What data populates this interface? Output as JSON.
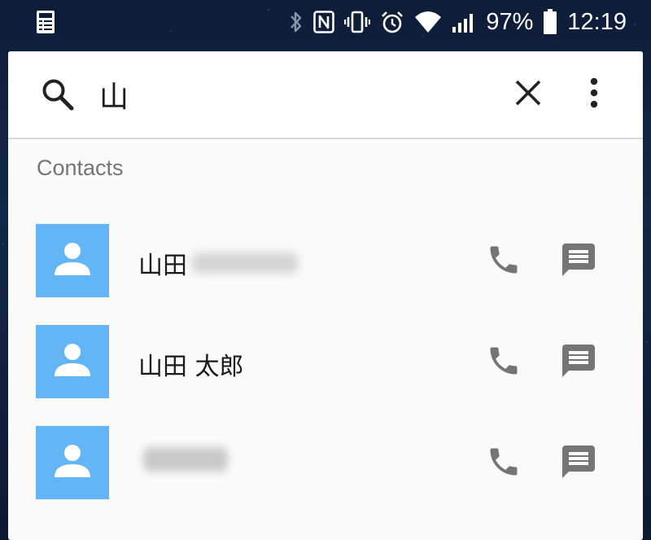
{
  "status_bar": {
    "battery_percent": "97%",
    "time": "12:19"
  },
  "search": {
    "query": "山"
  },
  "section": {
    "title": "Contacts"
  },
  "contacts": [
    {
      "name": "山田",
      "name_redacted": true
    },
    {
      "name": "山田 太郎",
      "name_redacted": false
    },
    {
      "name": "",
      "name_redacted": true
    }
  ],
  "icons": {
    "status": [
      "notification-app-icon",
      "bluetooth-icon",
      "nfc-icon",
      "vibrate-icon",
      "alarm-icon",
      "wifi-icon",
      "signal-icon",
      "battery-icon"
    ],
    "search_bar": [
      "search-icon",
      "close-icon",
      "more-vert-icon"
    ],
    "contact_row": [
      "person-icon",
      "phone-icon",
      "message-icon"
    ]
  },
  "colors": {
    "avatar_background": "#64b5f6",
    "action_icon": "#757575",
    "section_header": "#757575"
  }
}
